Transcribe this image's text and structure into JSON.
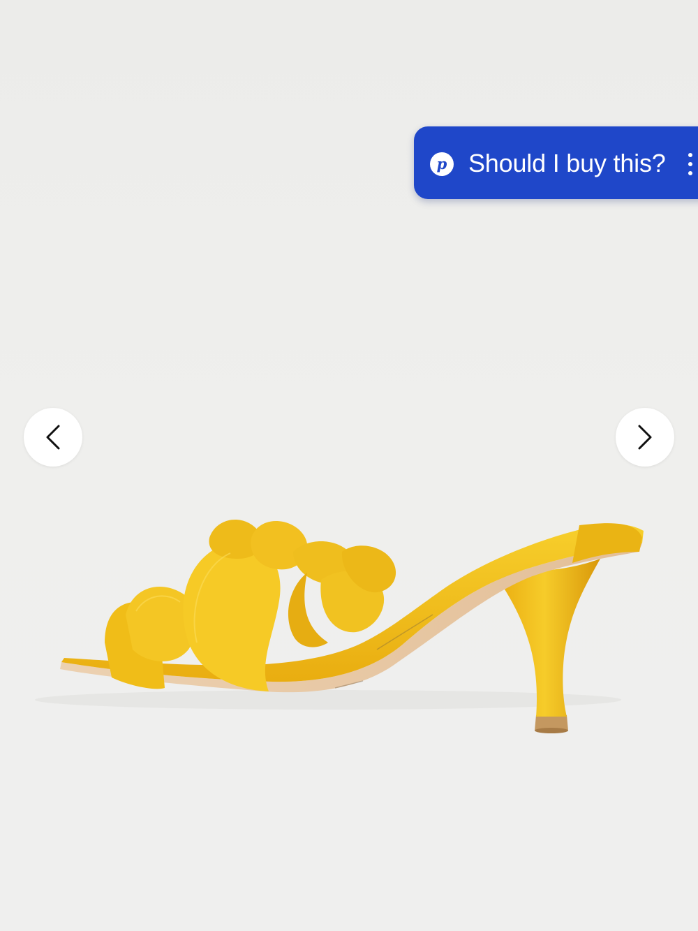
{
  "product": {
    "image_alt": "Yellow leather petal mule sandal with flared kitten heel",
    "colors": {
      "background": "#eeeeec",
      "sandal": "#f2c21a",
      "sole": "#e8c7a4"
    }
  },
  "carousel": {
    "prev_icon": "chevron-left-icon",
    "next_icon": "chevron-right-icon"
  },
  "assistant_prompt": {
    "logo_letter": "p",
    "label": "Should I buy this?",
    "menu_icon": "vertical-ellipsis-icon",
    "accent_color": "#1f47c9"
  }
}
